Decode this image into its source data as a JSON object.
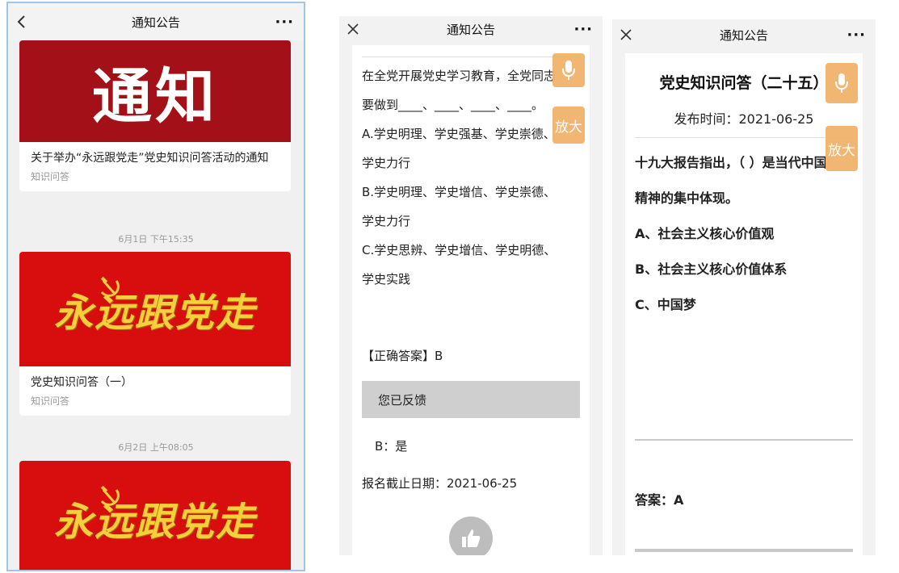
{
  "colors": {
    "accent": "#f0b36b",
    "party_red": "#d80d0d",
    "notice_red": "#a31017",
    "gold": "#f6cf3c"
  },
  "screen1": {
    "nav": {
      "title": "通知公告",
      "back_icon": "chevron-left-icon",
      "more": "···"
    },
    "cards": [
      {
        "banner_text": "通知",
        "title": "关于举办“永远跟党走”党史知识问答活动的通知",
        "tag": "知识问答"
      },
      {
        "banner_text": "永远跟党走",
        "title": "党史知识问答（一）",
        "tag": "知识问答"
      },
      {
        "banner_text": "永远跟党走"
      }
    ],
    "timestamps": [
      "6月1日 下午15:35",
      "6月2日 上午08:05"
    ]
  },
  "screen2": {
    "nav": {
      "title": "通知公告",
      "close_icon": "close-icon",
      "more": "···"
    },
    "question_lines": [
      "在全党开展党史学习教育，全党同志",
      "要做到____、____、____、____。"
    ],
    "options": [
      [
        "A.学史明理、学史强基、学史崇德、",
        "学史力行"
      ],
      [
        "B.学史明理、学史增信、学史崇德、",
        "学史力行"
      ],
      [
        "C.学史思辨、学史增信、学史明德、",
        "学史实践"
      ]
    ],
    "correct_answer": "【正确答案】B",
    "feedback_label": "您已反馈",
    "feedback_value": "B：是",
    "deadline": "报名截止日期：2021-06-25",
    "mic_icon": "microphone-icon",
    "zoom_label": "放大",
    "like_icon": "thumbs-up-icon"
  },
  "screen3": {
    "nav": {
      "title": "通知公告",
      "close_icon": "close-icon",
      "more": "···"
    },
    "title": "党史知识问答（二十五）",
    "publish_time": "发布时间：2021-06-25",
    "question_lines": [
      "十九大报告指出，（  ）是当代中国",
      "精神的集中体现。"
    ],
    "options": [
      "A、社会主义核心价值观",
      "B、社会主义核心价值体系",
      "C、中国梦"
    ],
    "answer": "答案：A",
    "mic_icon": "microphone-icon",
    "zoom_label": "放大"
  }
}
